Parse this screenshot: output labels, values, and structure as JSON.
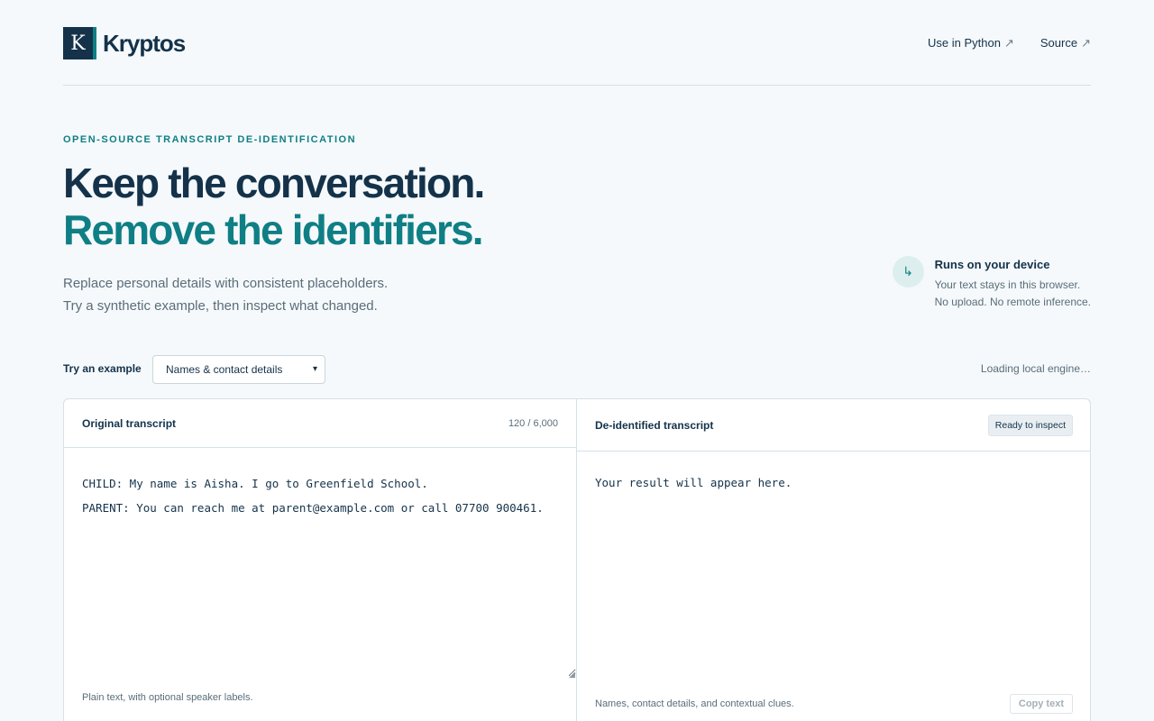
{
  "header": {
    "logo_letter": "K",
    "brand": "Kryptos",
    "nav": [
      {
        "label": "Use in Python",
        "arrow": "↗"
      },
      {
        "label": "Source",
        "arrow": "↗"
      }
    ]
  },
  "hero": {
    "eyebrow": "OPEN-SOURCE TRANSCRIPT DE-IDENTIFICATION",
    "title_line1": "Keep the conversation.",
    "title_line2": "Remove the identifiers.",
    "subtitle_line1": "Replace personal details with consistent placeholders.",
    "subtitle_line2": "Try a synthetic example, then inspect what changed."
  },
  "device_note": {
    "icon": "↳",
    "icon_name": "arrow-return-icon",
    "title": "Runs on your device",
    "line1": "Your text stays in this browser.",
    "line2": "No upload. No remote inference."
  },
  "example": {
    "label": "Try an example",
    "selected": "Names & contact details",
    "status": "Loading local engine…"
  },
  "original": {
    "title": "Original transcript",
    "counter": "120 / 6,000",
    "text": "CHILD: My name is Aisha. I go to Greenfield School.\nPARENT: You can reach me at parent@example.com or call 07700 900461.",
    "hint": "Plain text, with optional speaker labels."
  },
  "deidentified": {
    "title": "De-identified transcript",
    "badge": "Ready to inspect",
    "placeholder": "Your result will appear here.",
    "hint": "Names, contact details, and contextual clues.",
    "copy_label": "Copy text"
  },
  "colors": {
    "brand_navy": "#14324a",
    "accent_teal": "#0f7f85",
    "background": "#f5f9fb"
  }
}
